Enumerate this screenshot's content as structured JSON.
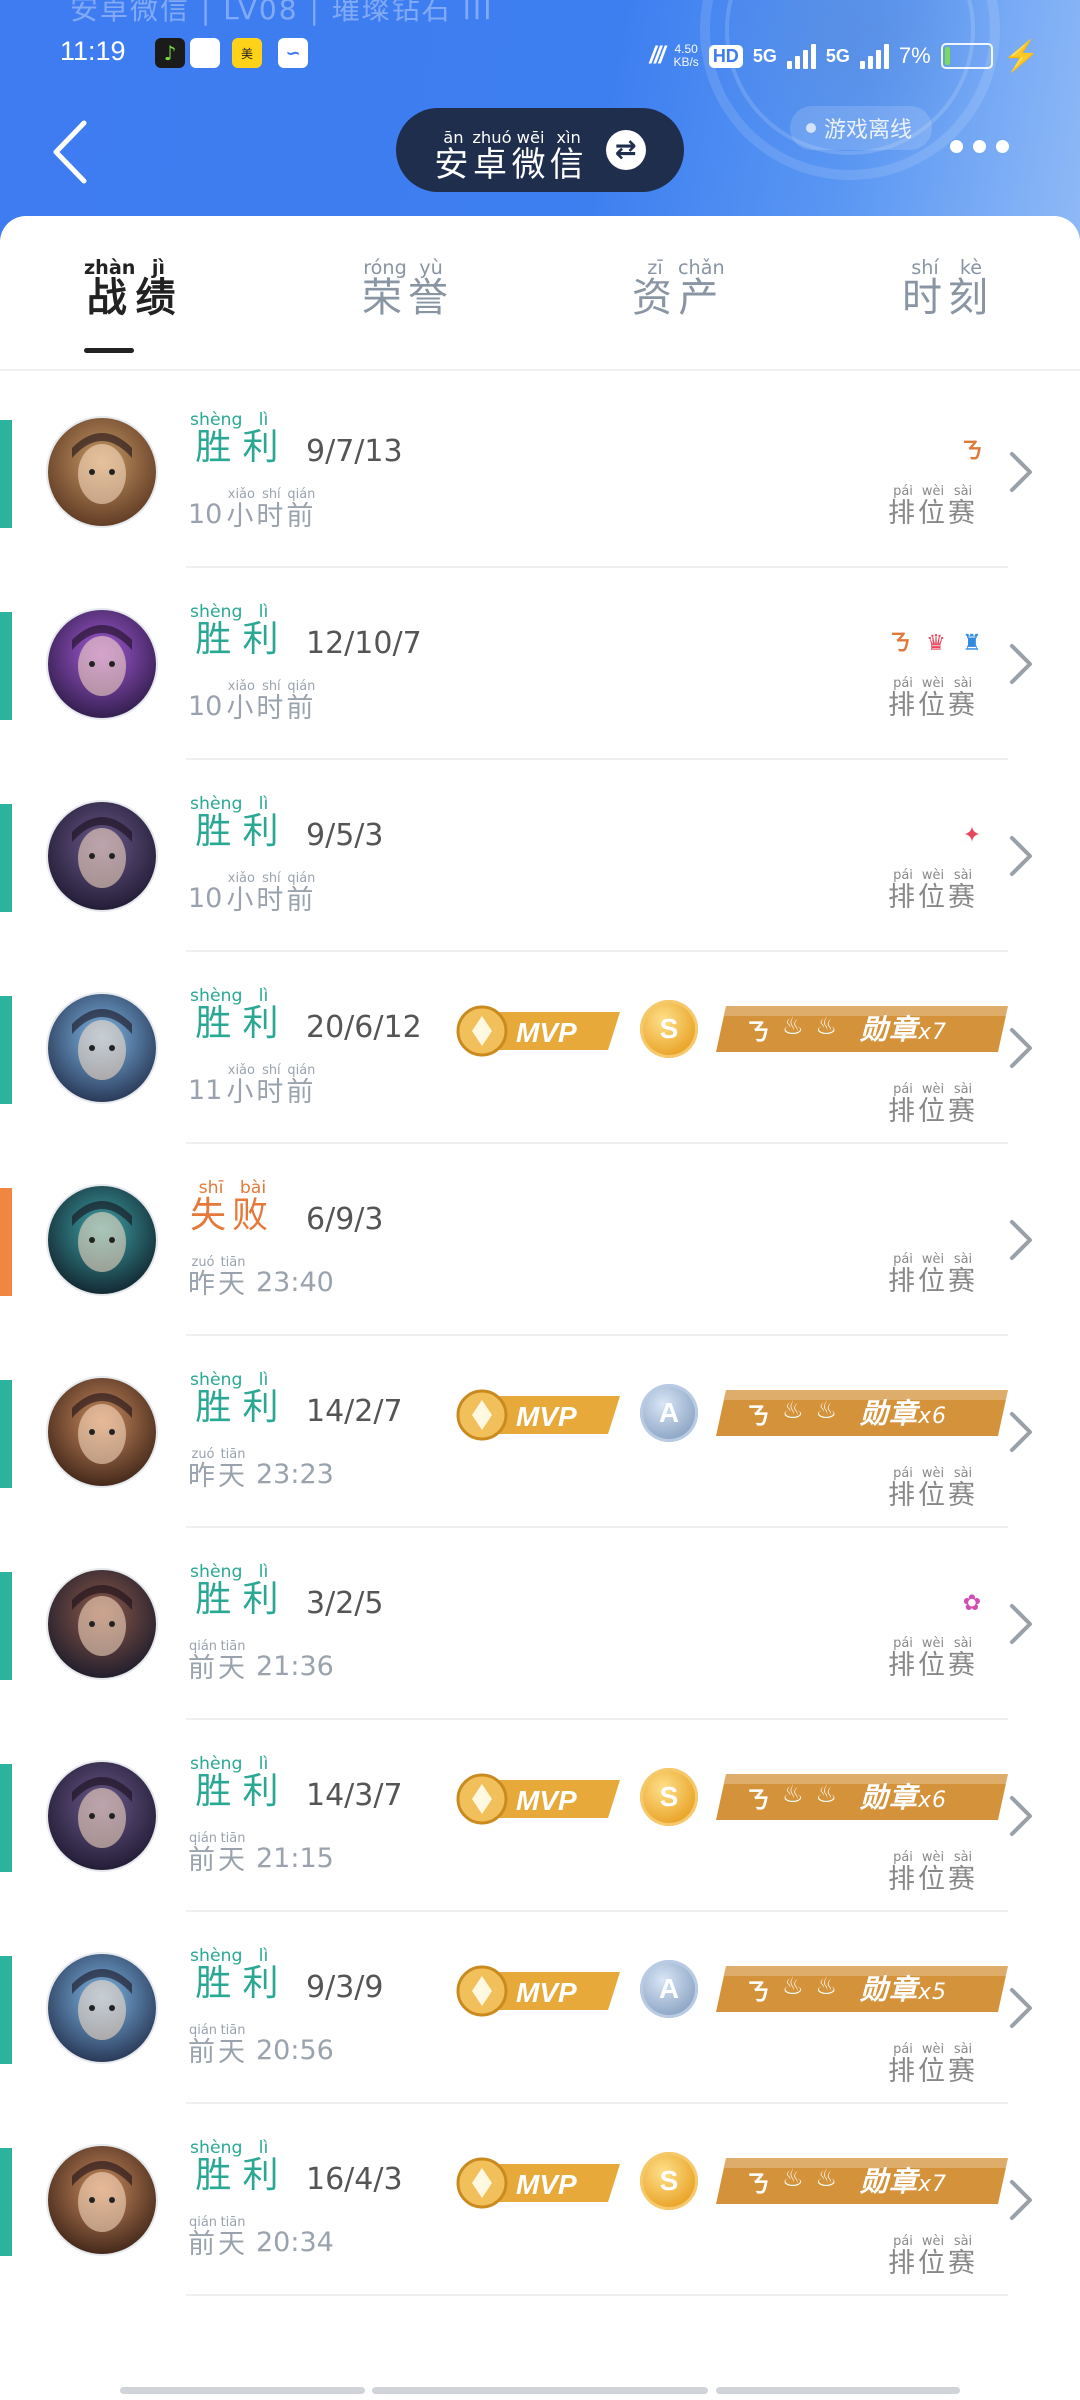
{
  "header": {
    "faded_title": "安卓微信 | LV08 | 璀璨钻石 III",
    "account_name": "安卓微信",
    "account_pinyin": [
      "ān",
      "zhuó",
      "wēi",
      "xìn"
    ],
    "account_chars": [
      "安",
      "卓",
      "微",
      "信"
    ],
    "offline_label": "游戏离线",
    "swap_symbol": "⇄"
  },
  "status_bar": {
    "time": "11:19",
    "speed_value": "4.50",
    "speed_unit": "KB/s",
    "hd": "HD",
    "net1": "5G",
    "net2": "5G",
    "battery": "7%"
  },
  "tabs": [
    {
      "chars": [
        "战",
        "绩"
      ],
      "pinyin": [
        "zhàn",
        "jì"
      ],
      "active": true
    },
    {
      "chars": [
        "荣",
        "誉"
      ],
      "pinyin": [
        "róng",
        "yù"
      ],
      "active": false
    },
    {
      "chars": [
        "资",
        "产"
      ],
      "pinyin": [
        "zī",
        "chǎn"
      ],
      "active": false
    },
    {
      "chars": [
        "时",
        "刻"
      ],
      "pinyin": [
        "shí",
        "kè"
      ],
      "active": false
    }
  ],
  "labels": {
    "win_chars": [
      "胜",
      "利"
    ],
    "win_pinyin": [
      "shèng",
      "lì"
    ],
    "lose_chars": [
      "失",
      "败"
    ],
    "lose_pinyin": [
      "shī",
      "bài"
    ],
    "mode_chars": [
      "排",
      "位",
      "赛"
    ],
    "mode_pinyin": [
      "pái",
      "wèi",
      "sài"
    ],
    "hours_ago_chars": [
      "小",
      "时",
      "前"
    ],
    "hours_ago_pinyin": [
      "xiǎo",
      "shí",
      "qián"
    ],
    "yesterday_chars": [
      "昨",
      "天"
    ],
    "yesterday_pinyin": [
      "zuó",
      "tiān"
    ],
    "daybefore_chars": [
      "前",
      "天"
    ],
    "daybefore_pinyin": [
      "qián",
      "tiān"
    ],
    "mvp": "MVP",
    "medal_word": "勋章"
  },
  "colors": {
    "win": "#2bb39d",
    "lose": "#f08642",
    "header_blue": "#3f7cf1",
    "pill": "#1f2e4d"
  },
  "matches": [
    {
      "result": "win",
      "kda": "9/7/13",
      "time_type": "hours",
      "time_num": "10",
      "clock": "",
      "mvp": false,
      "grade": "",
      "medal_count": "",
      "badges": [
        {
          "icon": "rank-three-icon",
          "glyph": "ㄋ",
          "color": "#e07a3a"
        }
      ],
      "avatar": {
        "c1": "#c79a66",
        "c2": "#5a3520"
      }
    },
    {
      "result": "win",
      "kda": "12/10/7",
      "time_type": "hours",
      "time_num": "10",
      "clock": "",
      "mvp": false,
      "grade": "",
      "medal_count": "",
      "badges": [
        {
          "icon": "rank-three-icon",
          "glyph": "ㄋ",
          "color": "#e07a3a"
        },
        {
          "icon": "crown-icon",
          "glyph": "♛",
          "color": "#e8485c"
        },
        {
          "icon": "tower-icon",
          "glyph": "♜",
          "color": "#2f8ae0"
        }
      ],
      "avatar": {
        "c1": "#a45ad6",
        "c2": "#2b1a44"
      }
    },
    {
      "result": "win",
      "kda": "9/5/3",
      "time_type": "hours",
      "time_num": "10",
      "clock": "",
      "mvp": false,
      "grade": "",
      "medal_count": "",
      "badges": [
        {
          "icon": "shield-icon",
          "glyph": "✦",
          "color": "#e8485c"
        }
      ],
      "avatar": {
        "c1": "#6a5a8a",
        "c2": "#1e1830"
      }
    },
    {
      "result": "win",
      "kda": "20/6/12",
      "time_type": "hours",
      "time_num": "11",
      "clock": "",
      "mvp": true,
      "grade": "S",
      "medal_count": "x7",
      "badges": [],
      "avatar": {
        "c1": "#7fb8e6",
        "c2": "#23304e"
      }
    },
    {
      "result": "lose",
      "kda": "6/9/3",
      "time_type": "yesterday",
      "time_num": "",
      "clock": "23:40",
      "mvp": false,
      "grade": "",
      "medal_count": "",
      "badges": [],
      "avatar": {
        "c1": "#3fa3a8",
        "c2": "#10202a"
      }
    },
    {
      "result": "win",
      "kda": "14/2/7",
      "time_type": "yesterday",
      "time_num": "",
      "clock": "23:23",
      "mvp": true,
      "grade": "A",
      "medal_count": "x6",
      "badges": [],
      "avatar": {
        "c1": "#c98a5e",
        "c2": "#3b2216"
      }
    },
    {
      "result": "win",
      "kda": "3/2/5",
      "time_type": "daybefore",
      "time_num": "",
      "clock": "21:36",
      "mvp": false,
      "grade": "",
      "medal_count": "",
      "badges": [
        {
          "icon": "lotus-icon",
          "glyph": "✿",
          "color": "#d24fb2"
        }
      ],
      "avatar": {
        "c1": "#8e5a4a",
        "c2": "#1a1a2a"
      }
    },
    {
      "result": "win",
      "kda": "14/3/7",
      "time_type": "daybefore",
      "time_num": "",
      "clock": "21:15",
      "mvp": true,
      "grade": "S",
      "medal_count": "x6",
      "badges": [],
      "avatar": {
        "c1": "#6a5a8a",
        "c2": "#1e1830"
      }
    },
    {
      "result": "win",
      "kda": "9/3/9",
      "time_type": "daybefore",
      "time_num": "",
      "clock": "20:56",
      "mvp": true,
      "grade": "A",
      "medal_count": "x5",
      "badges": [],
      "avatar": {
        "c1": "#7fb8e6",
        "c2": "#23304e"
      }
    },
    {
      "result": "win",
      "kda": "16/4/3",
      "time_type": "daybefore",
      "time_num": "",
      "clock": "20:34",
      "mvp": true,
      "grade": "S",
      "medal_count": "x7",
      "badges": [],
      "avatar": {
        "c1": "#c98a5e",
        "c2": "#3b2216"
      }
    }
  ]
}
